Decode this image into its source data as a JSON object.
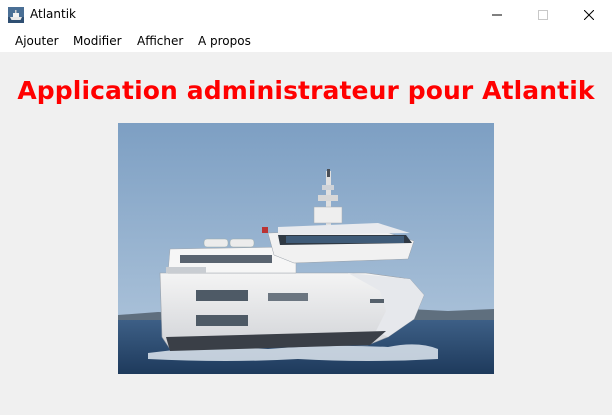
{
  "window": {
    "title": "Atlantik",
    "app_icon": "ferry-icon",
    "controls": [
      "minimize-icon",
      "maximize-icon",
      "close-icon"
    ]
  },
  "menu": {
    "items": [
      {
        "label": "Ajouter"
      },
      {
        "label": "Modifier"
      },
      {
        "label": "Afficher"
      },
      {
        "label": "A propos"
      }
    ]
  },
  "main": {
    "heading": "Application administrateur pour Atlantik",
    "heading_color": "#ff0000",
    "image_subject": "ferry-photo"
  }
}
